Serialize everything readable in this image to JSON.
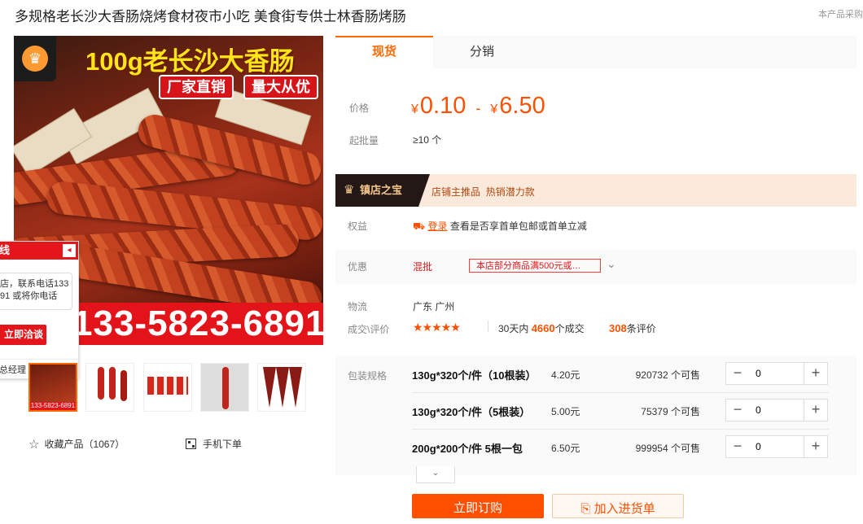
{
  "page": {
    "title": "多规格老长沙大香肠烧烤食材夜市小吃 美食街专供士林香肠烤肠",
    "corner_note": "本产品采购"
  },
  "image": {
    "headline": "100g老长沙大香肠",
    "tag1": "厂家直销",
    "tag2": "量大从优",
    "phone": "133-5823-6891",
    "crown": "♛"
  },
  "chat": {
    "header": "线",
    "close": "◂",
    "line1": "店，联系电话133",
    "line2": "91 或将你电话",
    "button": "立即洽谈",
    "footer": "总经理"
  },
  "thumbnails": [
    {
      "label": "133-5823-6891"
    },
    {
      "label": ""
    },
    {
      "label": ""
    },
    {
      "label": ""
    },
    {
      "label": ""
    }
  ],
  "actions": {
    "favorite": "收藏产品（1067）",
    "mobile_order": "手机下单"
  },
  "tabs": {
    "spot": "现货",
    "distribution": "分销"
  },
  "pricing": {
    "price_label": "价格",
    "currency": "¥",
    "min_price": "0.10",
    "dash": "-",
    "max_price": "6.50",
    "moq_label": "起批量",
    "moq_value": "≥10 个"
  },
  "promo": {
    "badge": "镇店之宝",
    "crown": "♛",
    "text1": "店铺主推品",
    "text2": "热销潜力款"
  },
  "rights": {
    "label": "权益",
    "login": "登录",
    "desc": "查看是否享首单包邮或首单立减"
  },
  "discount": {
    "label": "优惠",
    "type": "混批",
    "coupon": "本店部分商品满500元或…",
    "chevron": "⌄"
  },
  "logistics": {
    "label": "物流",
    "value": "广东 广州"
  },
  "reviews": {
    "label": "成交\\评价",
    "stars": "★★★★★",
    "rating": 4.5,
    "sales_prefix": "30天内",
    "sales_count": "4660",
    "sales_suffix": "个成交",
    "review_count": "308",
    "review_suffix": "条评价"
  },
  "sku": {
    "label": "包装规格",
    "rows": [
      {
        "name": "130g*320个/件（10根装）",
        "price": "4.20元",
        "stock": "920732",
        "unit": "个可售",
        "qty": "0"
      },
      {
        "name": "130g*320个/件（5根装）",
        "price": "5.00元",
        "stock": "75379",
        "unit": "个可售",
        "qty": "0"
      },
      {
        "name": "200g*200个/件 5根一包",
        "price": "6.50元",
        "stock": "999954",
        "unit": "个可售",
        "qty": "0"
      }
    ],
    "minus": "−",
    "plus": "+",
    "expand": "⌄"
  },
  "buttons": {
    "buy_now": "立即订购",
    "add_cart": "加入进货单"
  }
}
